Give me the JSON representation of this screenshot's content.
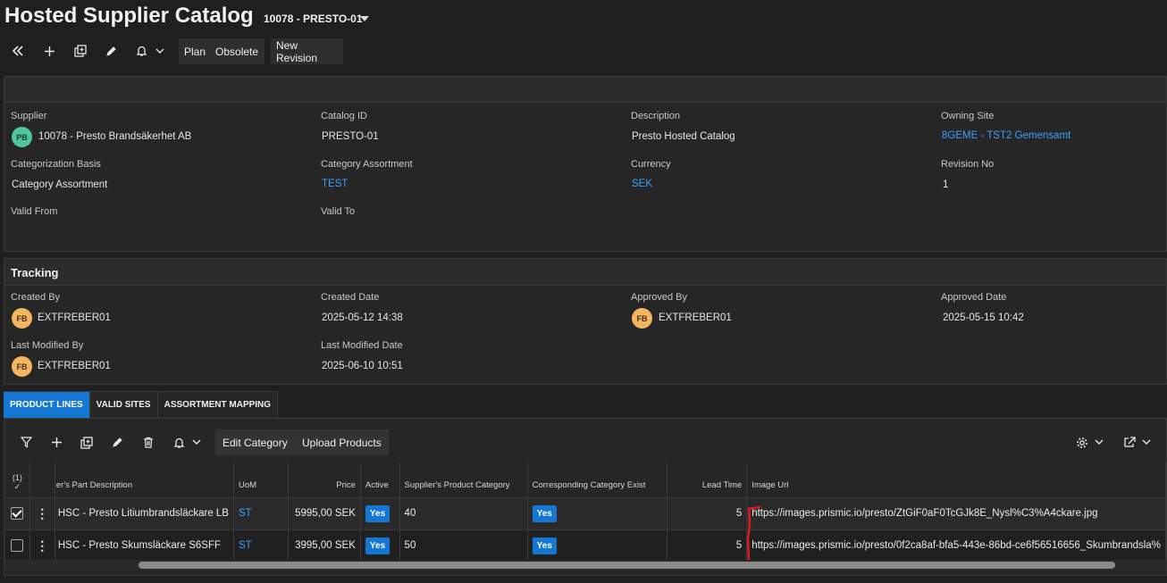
{
  "header": {
    "title": "Hosted Supplier Catalog",
    "subtitle": "10078 - PRESTO-01"
  },
  "toolbar": {
    "plan_label": "Plan",
    "obsolete_label": "Obsolete",
    "new_revision_label": "New Revision"
  },
  "details": {
    "supplier_label": "Supplier",
    "supplier_avatar": "PB",
    "supplier_value": "10078 - Presto Brandsäkerhet AB",
    "catalog_id_label": "Catalog ID",
    "catalog_id_value": "PRESTO-01",
    "description_label": "Description",
    "description_value": "Presto Hosted Catalog",
    "owning_site_label": "Owning Site",
    "owning_site_value": "8GEME - TST2 Gemensamt",
    "categorization_basis_label": "Categorization Basis",
    "categorization_basis_value": "Category Assortment",
    "category_assortment_label": "Category Assortment",
    "category_assortment_value": "TEST",
    "currency_label": "Currency",
    "currency_value": "SEK",
    "revision_no_label": "Revision No",
    "revision_no_value": "1",
    "valid_from_label": "Valid From",
    "valid_to_label": "Valid To"
  },
  "tracking": {
    "heading": "Tracking",
    "created_by_label": "Created By",
    "created_by_avatar": "FB",
    "created_by_value": "EXTFREBER01",
    "created_date_label": "Created Date",
    "created_date_value": "2025-05-12 14:38",
    "approved_by_label": "Approved By",
    "approved_by_avatar": "FB",
    "approved_by_value": "EXTFREBER01",
    "approved_date_label": "Approved Date",
    "approved_date_value": "2025-05-15 10:42",
    "last_modified_by_label": "Last Modified By",
    "last_modified_by_avatar": "FB",
    "last_modified_by_value": "EXTFREBER01",
    "last_modified_date_label": "Last Modified Date",
    "last_modified_date_value": "2025-06-10 10:51"
  },
  "tabs": [
    "PRODUCT LINES",
    "VALID SITES",
    "ASSORTMENT MAPPING"
  ],
  "grid_toolbar": {
    "edit_category_label": "Edit Category",
    "upload_products_label": "Upload Products"
  },
  "grid": {
    "selection_count": "(1)",
    "columns": {
      "description": "er's Part Description",
      "uom": "UoM",
      "price": "Price",
      "active": "Active",
      "supplier_category": "Supplier's Product Category",
      "corresponding_category": "Corresponding Category Exist",
      "lead_time": "Lead Time",
      "image_url": "Image Url"
    },
    "rows": [
      {
        "description": "HSC - Presto Litiumbrandsläckare LB",
        "uom": "ST",
        "price": "5995,00 SEK",
        "active": "Yes",
        "supplier_category": "40",
        "corresponding": "Yes",
        "lead_time": "5",
        "image_url": "https://images.prismic.io/presto/ZtGiF0aF0TcGJk8E_Nysl%C3%A4ckare.jpg"
      },
      {
        "description": "HSC - Presto Skumsläckare S6SFF",
        "uom": "ST",
        "price": "3995,00 SEK",
        "active": "Yes",
        "supplier_category": "50",
        "corresponding": "Yes",
        "lead_time": "5",
        "image_url": "https://images.prismic.io/presto/0f2ca8af-bfa5-443e-86bd-ce6f56516656_Skumbrandsla%"
      }
    ]
  }
}
